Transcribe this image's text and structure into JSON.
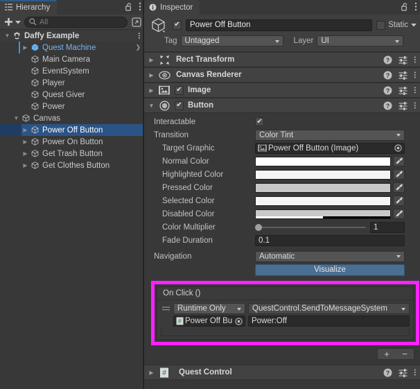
{
  "hierarchy": {
    "tab_label": "Hierarchy",
    "tab_icon": "hierarchy-icon",
    "lock_icon": "lock-open-icon",
    "menu_icon": "kebab-menu-icon",
    "toolbar": {
      "create_label": "+",
      "create_dropdown_icon": "chevron-down-icon",
      "search_icon": "search-icon",
      "search_value": "",
      "search_placeholder": "All",
      "search_mode_icon": "search-dropdown-icon",
      "visibility_icon": "open-in-new-icon"
    },
    "items": [
      {
        "label": "Daffy Example",
        "depth": 0,
        "arrow": "down",
        "icon": "unity-scene-icon",
        "kind": "scene",
        "selected": false,
        "has_menu": true
      },
      {
        "label": "Quest Machine",
        "depth": 2,
        "arrow": "right",
        "icon": "prefab-cube-icon",
        "kind": "prefab",
        "selected": false,
        "has_chevron": true
      },
      {
        "label": "Main Camera",
        "depth": 2,
        "arrow": "none",
        "icon": "gameobject-cube-icon",
        "kind": "gameobject",
        "selected": false
      },
      {
        "label": "EventSystem",
        "depth": 2,
        "arrow": "none",
        "icon": "gameobject-cube-icon",
        "kind": "gameobject",
        "selected": false
      },
      {
        "label": "Player",
        "depth": 2,
        "arrow": "none",
        "icon": "gameobject-cube-icon",
        "kind": "gameobject",
        "selected": false
      },
      {
        "label": "Quest Giver",
        "depth": 2,
        "arrow": "none",
        "icon": "gameobject-cube-icon",
        "kind": "gameobject",
        "selected": false
      },
      {
        "label": "Power",
        "depth": 2,
        "arrow": "none",
        "icon": "gameobject-cube-icon",
        "kind": "gameobject",
        "selected": false
      },
      {
        "label": "Canvas",
        "depth": 1,
        "arrow": "down",
        "icon": "gameobject-cube-icon",
        "kind": "gameobject",
        "selected": false
      },
      {
        "label": "Power Off Button",
        "depth": 2,
        "arrow": "right",
        "icon": "gameobject-cube-icon",
        "kind": "gameobject",
        "selected": true
      },
      {
        "label": "Power On Button",
        "depth": 2,
        "arrow": "right",
        "icon": "gameobject-cube-icon",
        "kind": "gameobject",
        "selected": false
      },
      {
        "label": "Get Trash Button",
        "depth": 2,
        "arrow": "right",
        "icon": "gameobject-cube-icon",
        "kind": "gameobject",
        "selected": false
      },
      {
        "label": "Get Clothes Button",
        "depth": 2,
        "arrow": "right",
        "icon": "gameobject-cube-icon",
        "kind": "gameobject",
        "selected": false
      }
    ]
  },
  "inspector": {
    "tab_label": "Inspector",
    "tab_icon": "info-icon",
    "lock_icon": "lock-open-icon",
    "menu_icon": "kebab-menu-icon",
    "object_header": {
      "object_icon": "gameobject-cube-icon",
      "enabled": true,
      "name_value": "Power Off Button",
      "static_label": "Static",
      "static_checked": false,
      "static_dropdown_icon": "chevron-down-icon",
      "tag_label": "Tag",
      "tag_value": "Untagged",
      "layer_label": "Layer",
      "layer_value": "UI"
    },
    "components": [
      {
        "title": "Rect Transform",
        "icon": "rect-transform-icon",
        "expanded": false,
        "has_enable_toggle": false
      },
      {
        "title": "Canvas Renderer",
        "icon": "canvas-renderer-eye-icon",
        "expanded": false,
        "has_enable_toggle": false
      },
      {
        "title": "Image",
        "icon": "image-component-icon",
        "expanded": false,
        "has_enable_toggle": true,
        "enabled": true
      },
      {
        "title": "Button",
        "icon": "button-component-icon",
        "expanded": true,
        "has_enable_toggle": true,
        "enabled": true
      }
    ],
    "component_header_icons": {
      "help": "help-icon",
      "preset": "preset-icon",
      "menu": "kebab-menu-icon"
    },
    "button_props": {
      "interactable_label": "Interactable",
      "interactable_checked": true,
      "transition_label": "Transition",
      "transition_value": "Color Tint",
      "target_graphic_label": "Target Graphic",
      "target_graphic_value": "Power Off Button (Image)",
      "target_graphic_icon": "image-component-icon",
      "target_graphic_picker_icon": "object-picker-icon",
      "colors": [
        {
          "label": "Normal Color",
          "hex": "#FFFFFF",
          "alpha": 1
        },
        {
          "label": "Highlighted Color",
          "hex": "#F5F5F5",
          "alpha": 1
        },
        {
          "label": "Pressed Color",
          "hex": "#C8C8C8",
          "alpha": 1
        },
        {
          "label": "Selected Color",
          "hex": "#F5F5F5",
          "alpha": 1
        },
        {
          "label": "Disabled Color",
          "hex": "#C8C8C8",
          "alpha": 0.5
        }
      ],
      "eyedropper_icon": "eyedropper-icon",
      "color_multiplier_label": "Color Multiplier",
      "color_multiplier_value": "1",
      "color_multiplier_slider_pct": 0,
      "fade_duration_label": "Fade Duration",
      "fade_duration_value": "0.1",
      "navigation_label": "Navigation",
      "navigation_value": "Automatic",
      "visualize_label": "Visualize"
    },
    "on_click": {
      "title": "On Click ()",
      "highlight_color": "#FF22FF",
      "entries": [
        {
          "drag_handle_icon": "drag-handle-icon",
          "mode_value": "Runtime Only",
          "function_value": "QuestControl.SendToMessageSystem",
          "target_object_value": "Power Off Bu",
          "target_object_icon": "script-icon",
          "target_object_picker_icon": "object-picker-icon",
          "argument_value": "Power:Off"
        }
      ],
      "add_label": "+",
      "remove_label": "−"
    },
    "footer_component": {
      "title": "Quest Control",
      "icon": "script-icon",
      "expanded": false
    }
  },
  "colors": {
    "panel_bg": "#383838",
    "header_bg": "#3f3f3f",
    "component_header_bg": "#424242",
    "selection_blue": "#2b5486",
    "selection_indent_blue": "#1f3d63",
    "prefab_blue": "#7ab4ef",
    "tab_accent": "#2c5d87",
    "visualize_blue": "#4a6f93",
    "highlight_magenta": "#FF22FF",
    "script_green": "#3f9a52"
  }
}
